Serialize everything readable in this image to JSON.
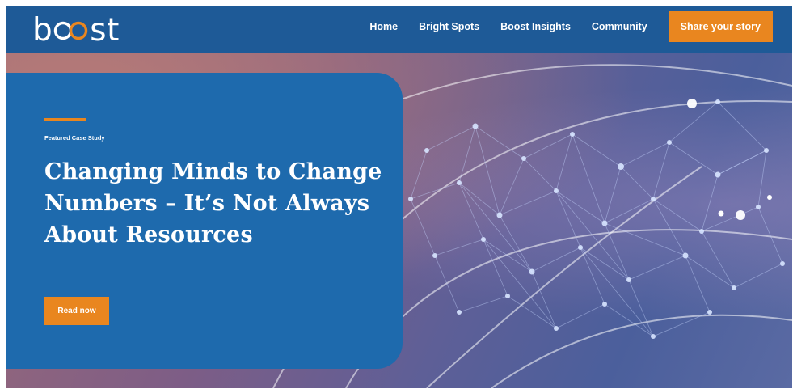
{
  "header": {
    "logo": {
      "prefix": "b",
      "suffix": "st",
      "icon": "double-o-logo-icon"
    },
    "nav": [
      {
        "label": "Home"
      },
      {
        "label": "Bright Spots"
      },
      {
        "label": "Boost Insights"
      },
      {
        "label": "Community"
      }
    ],
    "cta_label": "Share your story"
  },
  "hero": {
    "eyebrow": "Featured Case Study",
    "title": "Changing Minds to Change Numbers – It’s Not Always About Resources",
    "button_label": "Read now",
    "background": "network-graph-image"
  },
  "colors": {
    "header_bg": "#1e5a97",
    "card_bg": "#1e6aad",
    "accent": "#e9861f",
    "text": "#ffffff"
  }
}
